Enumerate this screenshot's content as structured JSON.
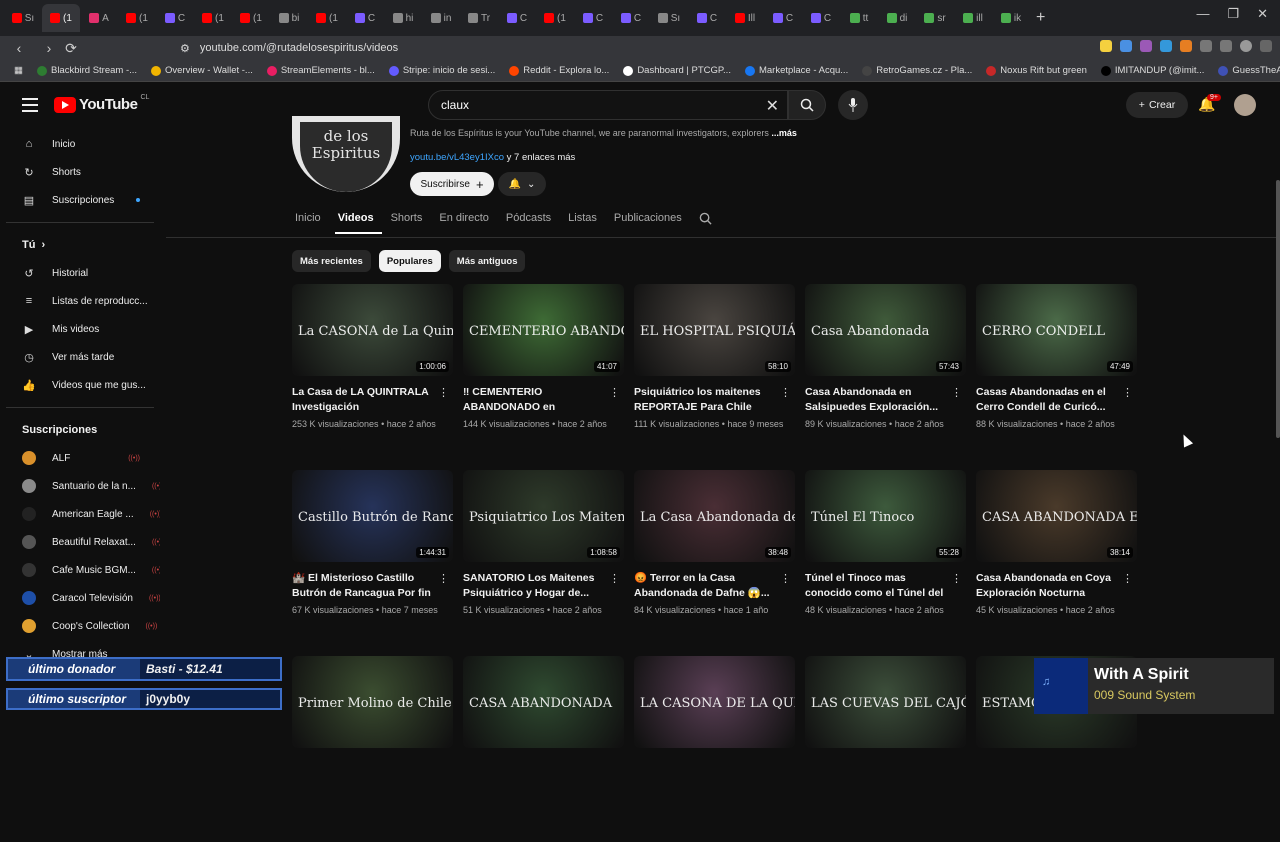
{
  "browser": {
    "tabs": [
      {
        "label": "Sı",
        "color": "#ff0000"
      },
      {
        "label": "(1",
        "color": "#ff0000",
        "active": true
      },
      {
        "label": "A",
        "color": "#e1306c"
      },
      {
        "label": "(1",
        "color": "#ff0000"
      },
      {
        "label": "C",
        "color": "#7b5cff"
      },
      {
        "label": "(1",
        "color": "#ff0000"
      },
      {
        "label": "(1",
        "color": "#ff0000"
      },
      {
        "label": "bi",
        "color": "#888"
      },
      {
        "label": "(1",
        "color": "#ff0000"
      },
      {
        "label": "C",
        "color": "#7b5cff"
      },
      {
        "label": "hi",
        "color": "#888"
      },
      {
        "label": "in",
        "color": "#888"
      },
      {
        "label": "Tr",
        "color": "#888"
      },
      {
        "label": "C",
        "color": "#7b5cff"
      },
      {
        "label": "(1",
        "color": "#ff0000"
      },
      {
        "label": "C",
        "color": "#7b5cff"
      },
      {
        "label": "C",
        "color": "#7b5cff"
      },
      {
        "label": "Sı",
        "color": "#888"
      },
      {
        "label": "C",
        "color": "#7b5cff"
      },
      {
        "label": "Ill",
        "color": "#ff0000"
      },
      {
        "label": "C",
        "color": "#7b5cff"
      },
      {
        "label": "C",
        "color": "#7b5cff"
      },
      {
        "label": "tt",
        "color": "#4caf50"
      },
      {
        "label": "di",
        "color": "#4caf50"
      },
      {
        "label": "sr",
        "color": "#4caf50"
      },
      {
        "label": "ill",
        "color": "#4caf50"
      },
      {
        "label": "ik",
        "color": "#4caf50"
      }
    ],
    "url": "youtube.com/@rutadelosespiritus/videos",
    "bookmarks": [
      {
        "label": "Blackbird Stream -...",
        "color": "#2e7d32"
      },
      {
        "label": "Overview - Wallet -...",
        "color": "#f0b400"
      },
      {
        "label": "StreamElements - bl...",
        "color": "#e91e63"
      },
      {
        "label": "Stripe: inicio de sesi...",
        "color": "#635bff"
      },
      {
        "label": "Reddit - Explora lo...",
        "color": "#ff4500"
      },
      {
        "label": "Dashboard | PTCGP...",
        "color": "#ffffff"
      },
      {
        "label": "Marketplace - Acqu...",
        "color": "#1877f2"
      },
      {
        "label": "RetroGames.cz - Pla...",
        "color": "#444"
      },
      {
        "label": "Noxus Rift but green",
        "color": "#c62828"
      },
      {
        "label": "IMITANDUP (@imit...",
        "color": "#000"
      },
      {
        "label": "GuessTheAge - Play...",
        "color": "#3f51b5"
      }
    ]
  },
  "youtube": {
    "logo": "YouTube",
    "country": "CL",
    "search_value": "claux",
    "create_label": "Crear",
    "notif_badge": "9+"
  },
  "sidebar": {
    "main": [
      {
        "label": "Inicio",
        "icon": "⌂"
      },
      {
        "label": "Shorts",
        "icon": "↻"
      },
      {
        "label": "Suscripciones",
        "icon": "▤"
      }
    ],
    "you_header": "Tú",
    "you": [
      {
        "label": "Historial",
        "icon": "↺"
      },
      {
        "label": "Listas de reproducc...",
        "icon": "≡"
      },
      {
        "label": "Mis videos",
        "icon": "▶"
      },
      {
        "label": "Ver más tarde",
        "icon": "◷"
      },
      {
        "label": "Videos que me gus...",
        "icon": "👍"
      }
    ],
    "subs_header": "Suscripciones",
    "subs": [
      {
        "label": "ALF",
        "color": "#d9902b"
      },
      {
        "label": "Santuario de la n...",
        "color": "#8a8a8a"
      },
      {
        "label": "American Eagle ...",
        "color": "#222"
      },
      {
        "label": "Beautiful Relaxat...",
        "color": "#555"
      },
      {
        "label": "Cafe Music BGM...",
        "color": "#333"
      },
      {
        "label": "Caracol Televisión",
        "color": "#1e4fa8"
      },
      {
        "label": "Coop's Collection",
        "color": "#e0a030"
      }
    ],
    "show_more": "Mostrar más"
  },
  "channel": {
    "avatar_text_1": "de los",
    "avatar_text_2": "Espiritus",
    "description": "Ruta de los Espíritus is your YouTube channel, we are paranormal investigators, explorers",
    "more": "...más",
    "link": "youtu.be/vL43ey1IXco",
    "links_more": " y 7 enlaces más",
    "subscribe": "Suscribirse",
    "tabs": [
      "Inicio",
      "Videos",
      "Shorts",
      "En directo",
      "Pódcasts",
      "Listas",
      "Publicaciones"
    ],
    "selected_tab": "Videos",
    "chips": [
      "Más recientes",
      "Populares",
      "Más antiguos"
    ],
    "selected_chip": "Populares"
  },
  "videos": [
    {
      "thumb_text": "La CASONA de La Quintrala",
      "duration": "1:00:06",
      "title": "La Casa de LA QUINTRALA Investigación PARANORMA...",
      "views": "253 K visualizaciones",
      "age": "hace 2 años",
      "bg": "#3c4a3a"
    },
    {
      "thumb_text": "CEMENTERIO ABANDONADO",
      "duration": "41:07",
      "title": "‼ CEMENTERIO ABANDONADO en Graneros...",
      "views": "144 K visualizaciones",
      "age": "hace 2 años",
      "bg": "#3e6b35"
    },
    {
      "thumb_text": "EL HOSPITAL PSIQUIÁTRICO DE LOS MAITENES",
      "duration": "58:10",
      "title": "Psiquiátrico los maitenes REPORTAJE Para Chile Ocul...",
      "views": "111 K visualizaciones",
      "age": "hace 9 meses",
      "bg": "#4a4540"
    },
    {
      "thumb_text": "Casa Abandonada",
      "duration": "57:43",
      "title": "Casa Abandonada en Salsipuedes Exploración...",
      "views": "89 K visualizaciones",
      "age": "hace 2 años",
      "bg": "#3f5a3a"
    },
    {
      "thumb_text": "CERRO CONDELL",
      "duration": "47:49",
      "title": "Casas Abandonadas en el Cerro Condell de Curicó...",
      "views": "88 K visualizaciones",
      "age": "hace 2 años",
      "bg": "#4b6a48"
    },
    {
      "thumb_text": "Castillo Butrón de Rancagua",
      "duration": "1:44:31",
      "title": "🏰 El Misterioso Castillo Butrón de Rancagua Por fin l...",
      "views": "67 K visualizaciones",
      "age": "hace 7 meses",
      "bg": "#26335a"
    },
    {
      "thumb_text": "Psiquiatrico Los Maitenes",
      "duration": "1:08:58",
      "title": "SANATORIO Los Maitenes Psiquiátrico y Hogar de...",
      "views": "51 K visualizaciones",
      "age": "hace 2 años",
      "bg": "#2e3a2a"
    },
    {
      "thumb_text": "La Casa Abandonada de Dafne",
      "duration": "38:48",
      "title": "😡 Terror en la Casa Abandonada de Dafne 😱...",
      "views": "84 K visualizaciones",
      "age": "hace 1 año",
      "bg": "#4a2e35"
    },
    {
      "thumb_text": "Túnel El Tinoco",
      "duration": "55:28",
      "title": "Túnel el Tinoco mas conocido como el Túnel del Diablo...",
      "views": "48 K visualizaciones",
      "age": "hace 2 años",
      "bg": "#3d5a3c"
    },
    {
      "thumb_text": "CASA ABANDONADA EN COYA",
      "duration": "38:14",
      "title": "Casa Abandonada en Coya Exploración Nocturna Urbex...",
      "views": "45 K visualizaciones",
      "age": "hace 2 años",
      "bg": "#4a3a2a"
    },
    {
      "thumb_text": "Primer Molino de Chile",
      "duration": "",
      "title": "",
      "views": "",
      "age": "",
      "bg": "#3b4d30"
    },
    {
      "thumb_text": "CASA ABANDONADA",
      "duration": "",
      "title": "",
      "views": "",
      "age": "",
      "bg": "#2f4a30"
    },
    {
      "thumb_text": "LA CASONA DE LA QUINTRALA",
      "duration": "",
      "title": "",
      "views": "",
      "age": "",
      "bg": "#5a3f55"
    },
    {
      "thumb_text": "LAS CUEVAS DEL CAJÓN DE MACHALI",
      "duration": "",
      "title": "",
      "views": "",
      "age": "",
      "bg": "#3c4e3a"
    },
    {
      "thumb_text": "ESTAMOS",
      "duration": "",
      "title": "",
      "views": "",
      "age": "",
      "bg": "#2a3a28"
    }
  ],
  "stream_overlay": {
    "donor_label": "último donador",
    "donor_value": "Basti - $12.41",
    "sub_label": "último suscriptor",
    "sub_value": "j0yyb0y",
    "song_title": "With A Spirit",
    "song_artist": "009 Sound System"
  }
}
